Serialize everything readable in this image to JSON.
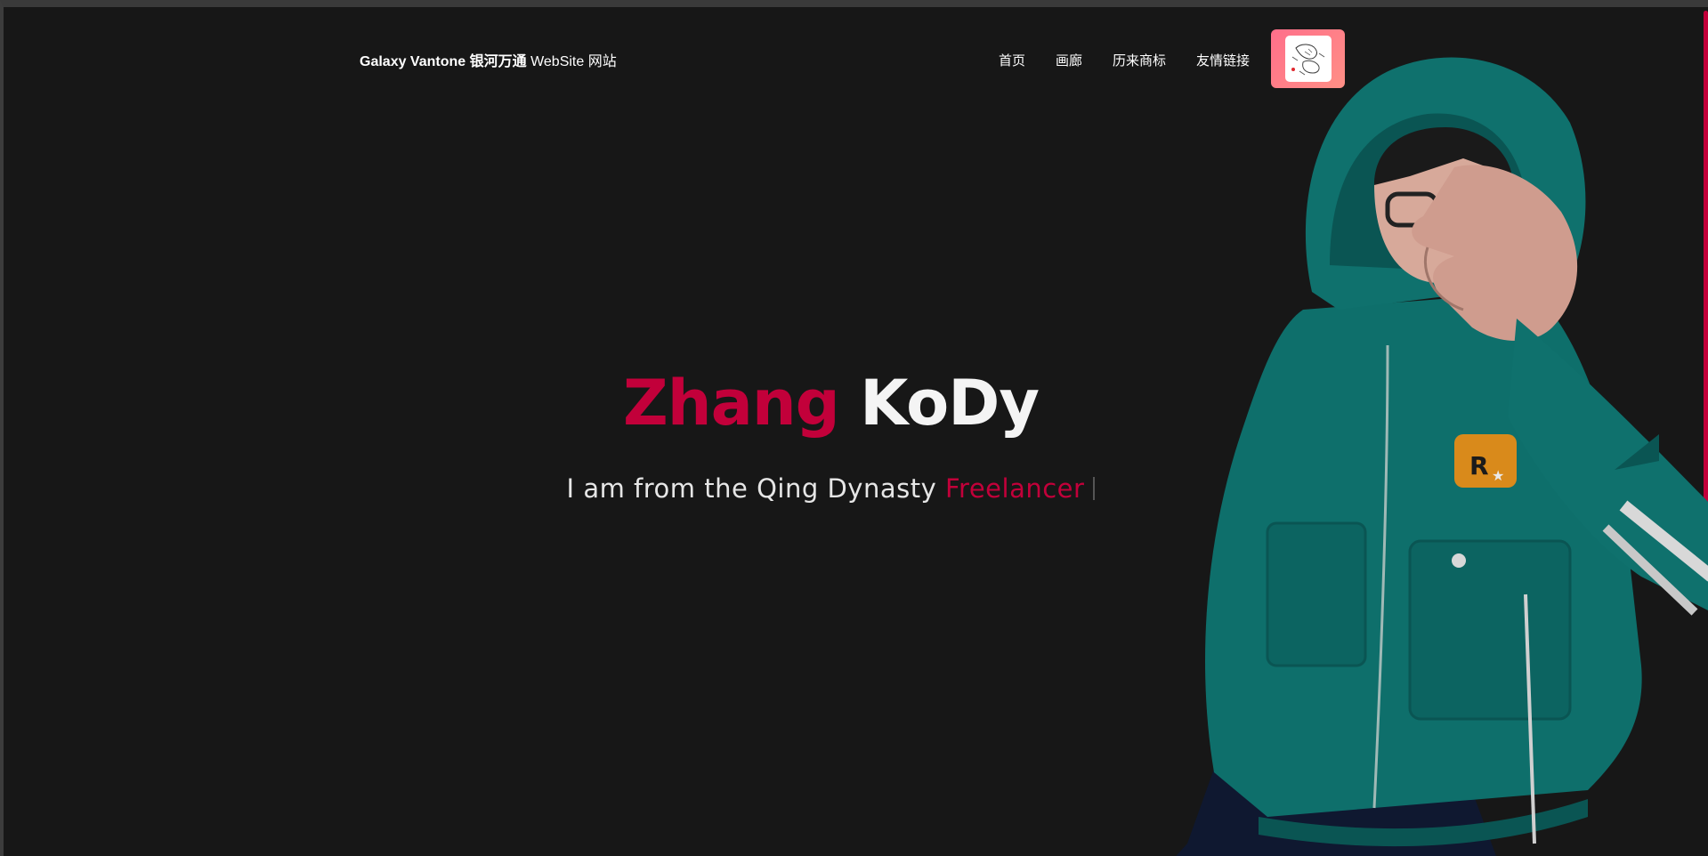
{
  "brand": {
    "bold": "Galaxy Vantone 银河万通",
    "light": "WebSite 网站"
  },
  "nav": {
    "home": "首页",
    "gallery": "画廊",
    "trademarks": "历来商标",
    "links": "友情链接"
  },
  "hero": {
    "first_name": "Zhang",
    "last_name": "KoDy",
    "subtitle": "I am from the Qing Dynasty",
    "role": "Freelancer"
  },
  "colors": {
    "accent": "#c2003a",
    "background": "#171717",
    "avatar_gradient_start": "#ff6f8a",
    "avatar_gradient_end": "#ff8f86"
  }
}
